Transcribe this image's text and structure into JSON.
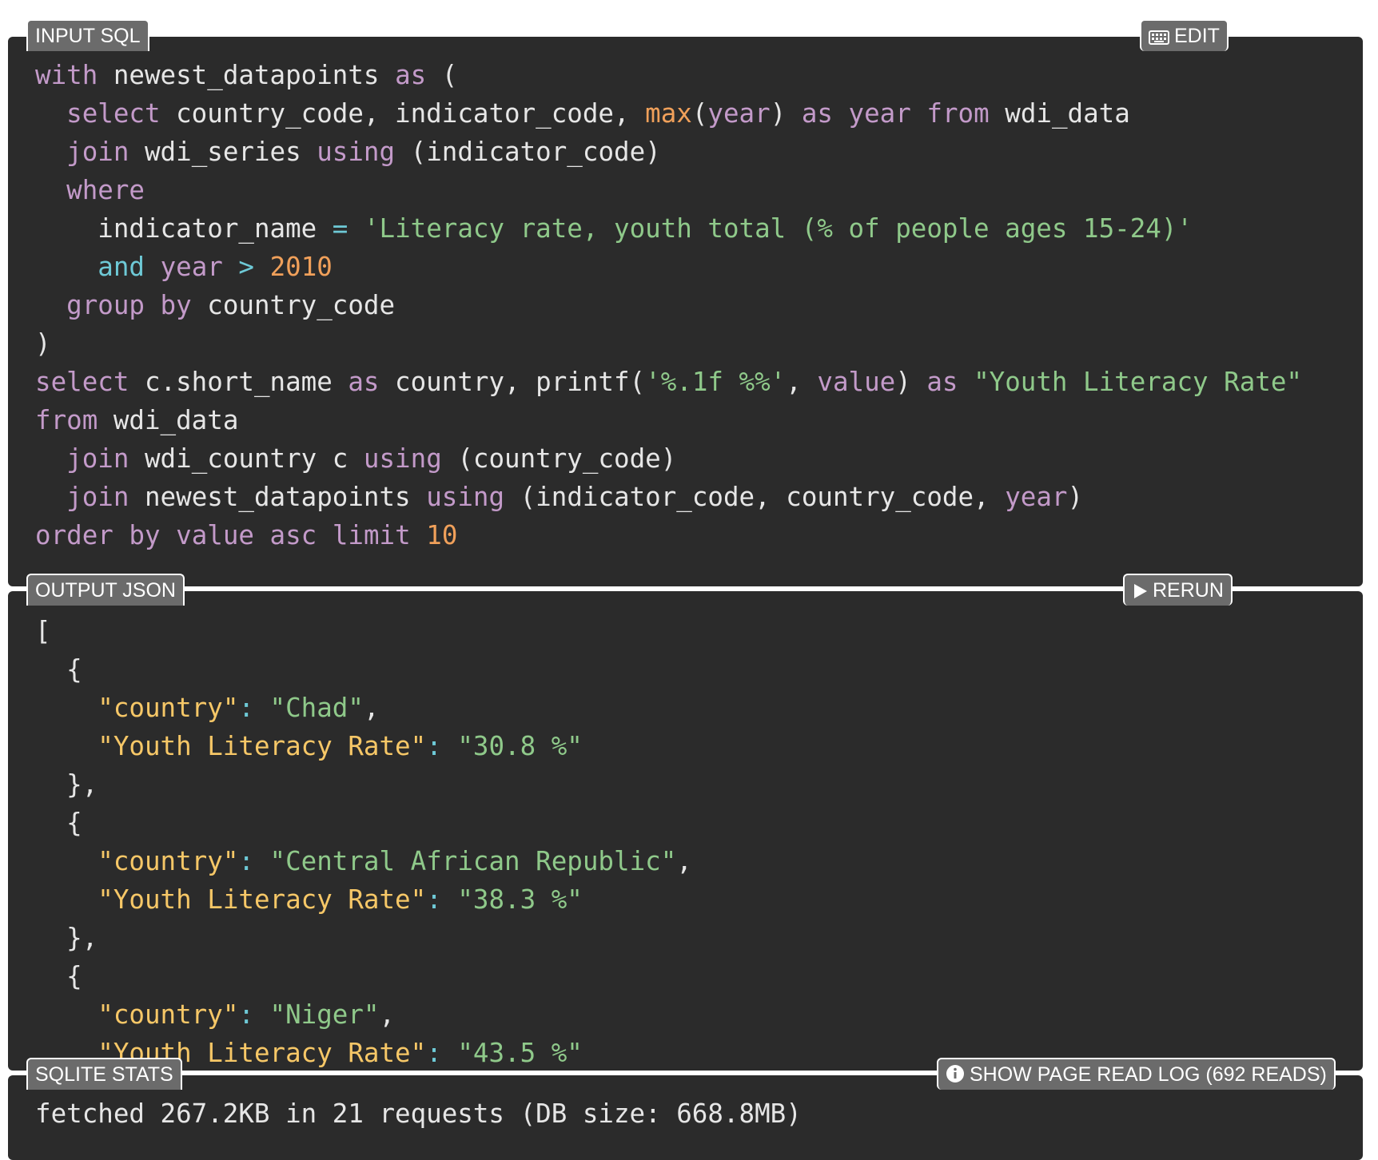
{
  "input_panel": {
    "label": "INPUT SQL",
    "edit_label": "EDIT"
  },
  "sql": {
    "l1": [
      "with",
      " newest_datapoints ",
      "as",
      " ("
    ],
    "l2": [
      "select",
      " country_code, indicator_code, ",
      "max",
      "(",
      "year",
      ") ",
      "as",
      " ",
      "year",
      " ",
      "from",
      " wdi_data"
    ],
    "l3": [
      "join",
      " wdi_series ",
      "using",
      " (indicator_code)"
    ],
    "l4": [
      "where"
    ],
    "l5": [
      "indicator_name ",
      "=",
      " ",
      "'Literacy rate, youth total (% of people ages 15-24)'"
    ],
    "l6": [
      "and",
      " ",
      "year",
      " ",
      ">",
      " ",
      "2010"
    ],
    "l7": [
      "group by",
      " country_code"
    ],
    "l8": [
      ")"
    ],
    "l9": [
      "select",
      " c.short_name ",
      "as",
      " country, printf(",
      "'%.1f %%'",
      ", ",
      "value",
      ") ",
      "as",
      " ",
      "\"Youth Literacy Rate\""
    ],
    "l10": [
      "from",
      " wdi_data"
    ],
    "l11": [
      "join",
      " wdi_country c ",
      "using",
      " (country_code)"
    ],
    "l12": [
      "join",
      " newest_datapoints ",
      "using",
      " (indicator_code, country_code, ",
      "year",
      ")"
    ],
    "l13": [
      "order by",
      " ",
      "value",
      " ",
      "asc",
      " ",
      "limit",
      " ",
      "10"
    ]
  },
  "output_panel": {
    "label": "OUTPUT JSON",
    "rerun_label": "RERUN"
  },
  "json_lines": {
    "open_bracket": "[",
    "open_brace": "{",
    "close_brace": "},",
    "key_country": "\"country\"",
    "key_rate": "\"Youth Literacy Rate\"",
    "colon": ": ",
    "comma": ","
  },
  "results": [
    {
      "country": "\"Chad\"",
      "rate": "\"30.8 %\""
    },
    {
      "country": "\"Central African Republic\"",
      "rate": "\"38.3 %\""
    },
    {
      "country": "\"Niger\"",
      "rate": "\"43.5 %\""
    }
  ],
  "stats_panel": {
    "label": "SQLITE STATS",
    "log_label": "SHOW PAGE READ LOG (692 READS)",
    "summary": "fetched 267.2KB in 21 requests (DB size: 668.8MB)"
  },
  "icons": {
    "edit": "keyboard-icon",
    "rerun": "play-icon",
    "log": "info-circle-icon"
  }
}
